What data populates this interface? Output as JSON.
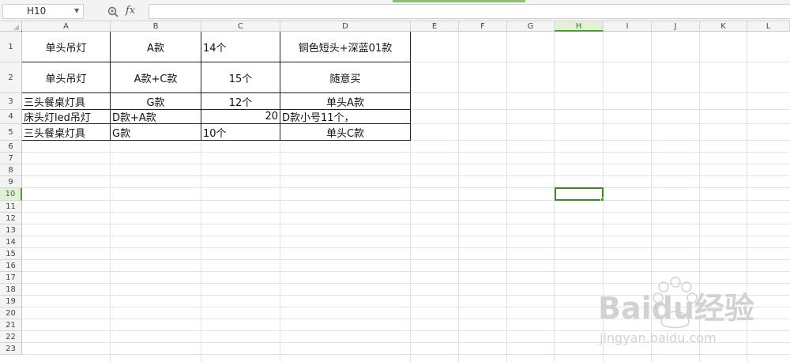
{
  "formula_bar": {
    "name_box": "H10",
    "fx_label": "fx",
    "formula_value": ""
  },
  "columns": [
    "A",
    "B",
    "C",
    "D",
    "E",
    "F",
    "G",
    "H",
    "I",
    "J",
    "K",
    "L"
  ],
  "selected_column": "H",
  "rows": [
    "1",
    "2",
    "3",
    "4",
    "5",
    "6",
    "7",
    "8",
    "9",
    "10",
    "11",
    "12",
    "13",
    "14",
    "15",
    "16",
    "17",
    "18",
    "19",
    "20",
    "21",
    "22",
    "23"
  ],
  "selected_row": "10",
  "cells": {
    "A1": "单头吊灯",
    "B1": "A款",
    "C1": "14个",
    "D1": "铜色短头+深蓝01款",
    "A2": "单头吊灯",
    "B2": "A款+C款",
    "C2": "15个",
    "D2": "随意买",
    "A3": "三头餐桌灯具",
    "B3": "G款",
    "C3": "12个",
    "D3": "单头A款",
    "A4": "床头灯led吊灯",
    "B4": "D款+A款",
    "C4": "20",
    "D4": "D款小号11个，",
    "A5": "三头餐桌灯具",
    "B5": "G款",
    "C5": "10个",
    "D5": "单头C款"
  },
  "watermark": {
    "brand": "Baidu经验",
    "url": "jingyan.baidu.com"
  },
  "colors": {
    "selection": "#3f8a23",
    "header_bg": "#f4f4f4",
    "gridline": "#e3e3e3"
  }
}
